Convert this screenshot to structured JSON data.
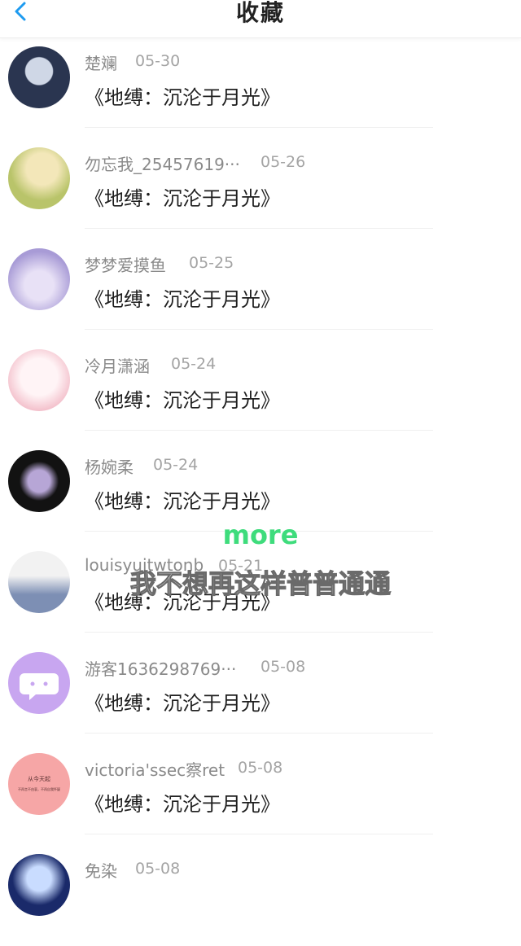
{
  "header": {
    "title": "收藏",
    "back_icon": "chevron-left-icon",
    "accent": "#1e9bf0"
  },
  "items": [
    {
      "user": "楚斓",
      "date": "05-30",
      "book": "《地缚：沉沦于月光》",
      "avatar_colors": [
        "#2a3550",
        "#cfd7e6"
      ]
    },
    {
      "user": "勿忘我_25457619···",
      "date": "05-26",
      "book": "《地缚：沉沦于月光》",
      "avatar_colors": [
        "#b9c46a",
        "#f3e7b9"
      ]
    },
    {
      "user": "梦梦爱摸鱼",
      "date": "05-25",
      "book": "《地缚：沉沦于月光》",
      "avatar_colors": [
        "#a89bd6",
        "#e8e1f6"
      ]
    },
    {
      "user": "冷月潇涵",
      "date": "05-24",
      "book": "《地缚：沉沦于月光》",
      "avatar_colors": [
        "#f1b6c3",
        "#fff4f6"
      ]
    },
    {
      "user": "杨婉柔",
      "date": "05-24",
      "book": "《地缚：沉沦于月光》",
      "avatar_colors": [
        "#121212",
        "#b7a6d6"
      ]
    },
    {
      "user": "louisyuitwtonb",
      "date": "05-21",
      "book": "《地缚：沉沦于月光》",
      "avatar_colors": [
        "#7d8fb4",
        "#f2f2f2"
      ]
    },
    {
      "user": "游客1636298769···",
      "date": "05-08",
      "book": "《地缚：沉沦于月光》",
      "avatar_colors": [
        "#c8a6f0",
        "#c8a6f0"
      ]
    },
    {
      "user": "victoria'ssec察ret",
      "date": "05-08",
      "book": "《地缚：沉沦于月光》",
      "avatar_colors": [
        "#f6a6a6",
        "#f6a6a6"
      ]
    },
    {
      "user": "免染",
      "date": "05-08",
      "book": "",
      "avatar_colors": [
        "#1a2a6a",
        "#c9dcff"
      ]
    }
  ],
  "avatar7_text": [
    "从今天起",
    "不再言不由衷，不再自我怀疑"
  ],
  "overlay": {
    "more": "more",
    "subtitle": "我不想再这样普普通通"
  }
}
